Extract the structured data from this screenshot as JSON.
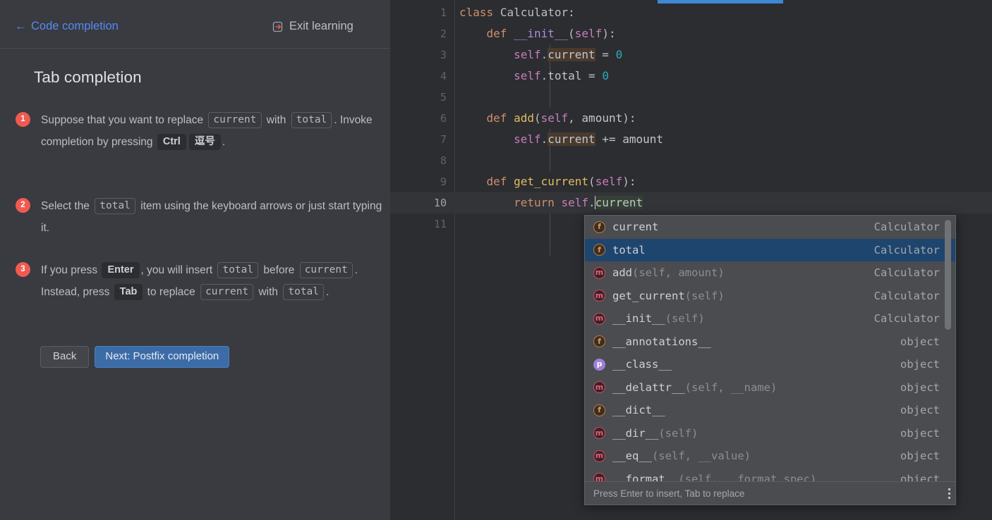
{
  "panel": {
    "back_link": "Code completion",
    "back_arrow_icon": "arrow-left-icon",
    "exit_label": "Exit learning",
    "exit_icon": "exit-door-icon",
    "title": "Tab completion",
    "accent_blue": "#548af7",
    "badge_red": "#f05a50",
    "steps": [
      {
        "number": "1",
        "parts": [
          {
            "t": "text",
            "v": "Suppose that you want to replace "
          },
          {
            "t": "code",
            "v": "current"
          },
          {
            "t": "text",
            "v": " with "
          },
          {
            "t": "code",
            "v": "total"
          },
          {
            "t": "text",
            "v": ". Invoke completion by pressing "
          },
          {
            "t": "key",
            "v": "Ctrl"
          },
          {
            "t": "key",
            "v": "逗号"
          },
          {
            "t": "text",
            "v": "."
          }
        ]
      },
      {
        "number": "2",
        "parts": [
          {
            "t": "text",
            "v": "Select the "
          },
          {
            "t": "code",
            "v": "total"
          },
          {
            "t": "text",
            "v": " item using the keyboard arrows or just start typing it."
          }
        ]
      },
      {
        "number": "3",
        "parts": [
          {
            "t": "text",
            "v": "If you press "
          },
          {
            "t": "key",
            "v": "Enter"
          },
          {
            "t": "text",
            "v": ", you will insert "
          },
          {
            "t": "code",
            "v": "total"
          },
          {
            "t": "text",
            "v": " before "
          },
          {
            "t": "code",
            "v": "current"
          },
          {
            "t": "text",
            "v": ". Instead, press "
          },
          {
            "t": "key",
            "v": "Tab"
          },
          {
            "t": "text",
            "v": " to replace "
          },
          {
            "t": "code",
            "v": "current"
          },
          {
            "t": "text",
            "v": " with "
          },
          {
            "t": "code",
            "v": "total"
          },
          {
            "t": "text",
            "v": "."
          }
        ]
      }
    ],
    "back_button": "Back",
    "next_button": "Next: Postfix completion"
  },
  "editor": {
    "progress_color": "#3f87d4",
    "line_numbers": [
      "1",
      "2",
      "3",
      "4",
      "5",
      "6",
      "7",
      "8",
      "9",
      "10",
      "11"
    ],
    "current_line": "10",
    "lines": [
      {
        "n": "1",
        "tokens": [
          {
            "c": "kw",
            "v": "class"
          },
          {
            "c": "punct",
            "v": " "
          },
          {
            "c": "cls",
            "v": "Calculator"
          },
          {
            "c": "punct",
            "v": ":"
          }
        ]
      },
      {
        "n": "2",
        "tokens": [
          {
            "c": "punct",
            "v": "    "
          },
          {
            "c": "kw",
            "v": "def"
          },
          {
            "c": "punct",
            "v": " "
          },
          {
            "c": "dunder",
            "v": "__init__"
          },
          {
            "c": "punct",
            "v": "("
          },
          {
            "c": "selfp",
            "v": "self"
          },
          {
            "c": "punct",
            "v": "):"
          }
        ]
      },
      {
        "n": "3",
        "tokens": [
          {
            "c": "punct",
            "v": "        "
          },
          {
            "c": "selfp",
            "v": "self"
          },
          {
            "c": "punct",
            "v": "."
          },
          {
            "c": "hl",
            "v": "current"
          },
          {
            "c": "punct",
            "v": " = "
          },
          {
            "c": "num",
            "v": "0"
          }
        ]
      },
      {
        "n": "4",
        "tokens": [
          {
            "c": "punct",
            "v": "        "
          },
          {
            "c": "selfp",
            "v": "self"
          },
          {
            "c": "punct",
            "v": "."
          },
          {
            "c": "ident",
            "v": "total"
          },
          {
            "c": "punct",
            "v": " = "
          },
          {
            "c": "num",
            "v": "0"
          }
        ]
      },
      {
        "n": "5",
        "tokens": []
      },
      {
        "n": "6",
        "tokens": [
          {
            "c": "punct",
            "v": "    "
          },
          {
            "c": "kw",
            "v": "def"
          },
          {
            "c": "punct",
            "v": " "
          },
          {
            "c": "fn",
            "v": "add"
          },
          {
            "c": "punct",
            "v": "("
          },
          {
            "c": "selfp",
            "v": "self"
          },
          {
            "c": "punct",
            "v": ", "
          },
          {
            "c": "ident",
            "v": "amount"
          },
          {
            "c": "punct",
            "v": "):"
          }
        ]
      },
      {
        "n": "7",
        "tokens": [
          {
            "c": "punct",
            "v": "        "
          },
          {
            "c": "selfp",
            "v": "self"
          },
          {
            "c": "punct",
            "v": "."
          },
          {
            "c": "hl",
            "v": "current"
          },
          {
            "c": "punct",
            "v": " += "
          },
          {
            "c": "ident",
            "v": "amount"
          }
        ]
      },
      {
        "n": "8",
        "tokens": []
      },
      {
        "n": "9",
        "tokens": [
          {
            "c": "punct",
            "v": "    "
          },
          {
            "c": "kw",
            "v": "def"
          },
          {
            "c": "punct",
            "v": " "
          },
          {
            "c": "fn",
            "v": "get_current"
          },
          {
            "c": "punct",
            "v": "("
          },
          {
            "c": "selfp",
            "v": "self"
          },
          {
            "c": "punct",
            "v": "):"
          }
        ]
      },
      {
        "n": "10",
        "tokens": [
          {
            "c": "punct",
            "v": "        "
          },
          {
            "c": "kw",
            "v": "return"
          },
          {
            "c": "punct",
            "v": " "
          },
          {
            "c": "selfp",
            "v": "self"
          },
          {
            "c": "punct",
            "v": "."
          },
          {
            "c": "caret",
            "v": ""
          },
          {
            "c": "green",
            "v": "current"
          }
        ]
      },
      {
        "n": "11",
        "tokens": []
      }
    ]
  },
  "completion": {
    "items": [
      {
        "icon": "field-icon",
        "kind": "f",
        "name": "current",
        "args": "",
        "type": "Calculator",
        "selected": false
      },
      {
        "icon": "field-icon",
        "kind": "f",
        "name": "total",
        "args": "",
        "type": "Calculator",
        "selected": true
      },
      {
        "icon": "method-icon",
        "kind": "m",
        "name": "add",
        "args": "(self, amount)",
        "type": "Calculator",
        "selected": false
      },
      {
        "icon": "method-icon",
        "kind": "m",
        "name": "get_current",
        "args": "(self)",
        "type": "Calculator",
        "selected": false
      },
      {
        "icon": "method-icon",
        "kind": "m",
        "name": "__init__",
        "args": "(self)",
        "type": "Calculator",
        "selected": false
      },
      {
        "icon": "field-icon",
        "kind": "f",
        "name": "__annotations__",
        "args": "",
        "type": "object",
        "selected": false
      },
      {
        "icon": "property-icon",
        "kind": "p",
        "name": "__class__",
        "args": "",
        "type": "object",
        "selected": false
      },
      {
        "icon": "method-icon",
        "kind": "m",
        "name": "__delattr__",
        "args": "(self, __name)",
        "type": "object",
        "selected": false
      },
      {
        "icon": "field-icon",
        "kind": "f",
        "name": "__dict__",
        "args": "",
        "type": "object",
        "selected": false
      },
      {
        "icon": "method-icon",
        "kind": "m",
        "name": "__dir__",
        "args": "(self)",
        "type": "object",
        "selected": false
      },
      {
        "icon": "method-icon",
        "kind": "m",
        "name": "__eq__",
        "args": "(self, __value)",
        "type": "object",
        "selected": false
      },
      {
        "icon": "method-icon",
        "kind": "m",
        "name": "__format__",
        "args": "(self, __format_spec)",
        "type": "object",
        "selected": false
      }
    ],
    "footer_hint": "Press Enter to insert, Tab to replace",
    "more_icon": "vertical-dots-icon",
    "selected_color": "#1e456e"
  }
}
